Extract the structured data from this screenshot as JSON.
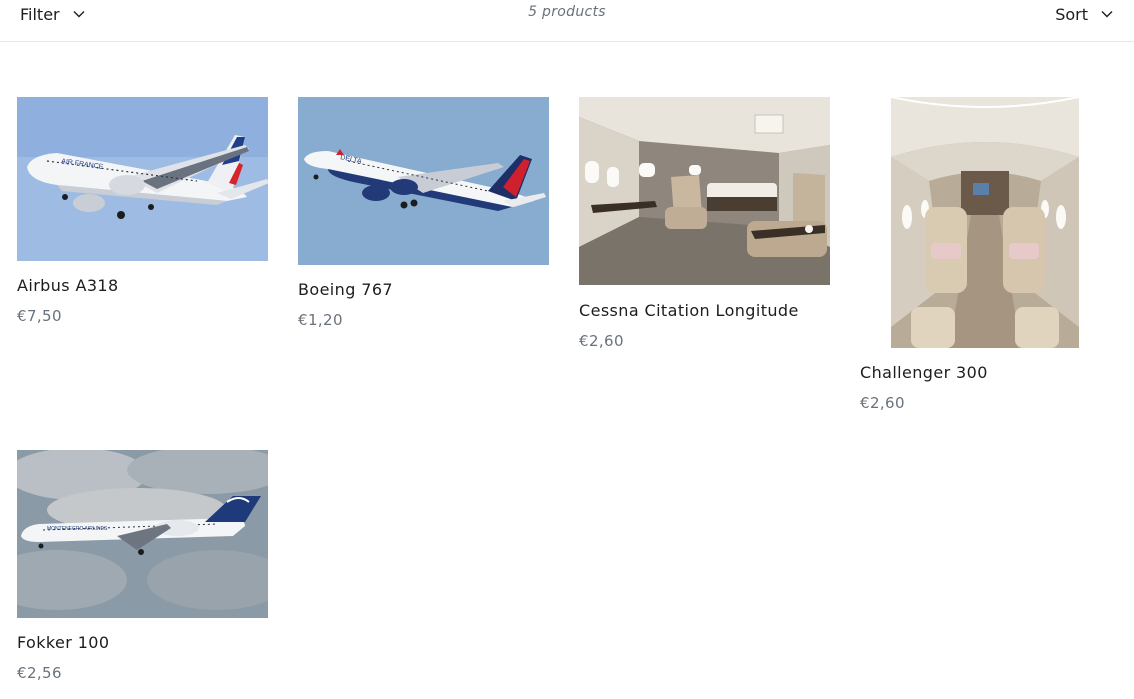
{
  "toolbar": {
    "filter_label": "Filter",
    "count_label": "5 products",
    "sort_label": "Sort"
  },
  "products": [
    {
      "title": "Airbus A318",
      "price": "€7,50",
      "image": "airbus-a318-photo"
    },
    {
      "title": "Boeing 767",
      "price": "€1,20",
      "image": "boeing-767-photo"
    },
    {
      "title": "Cessna Citation Longitude",
      "price": "€2,60",
      "image": "cessna-cabin-photo"
    },
    {
      "title": "Challenger 300",
      "price": "€2,60",
      "image": "challenger-cabin-photo"
    },
    {
      "title": "Fokker 100",
      "price": "€2,56",
      "image": "fokker-100-photo"
    }
  ],
  "colors": {
    "text": "#1c1d1d",
    "muted": "#69727b",
    "border": "#e6e6e6"
  }
}
